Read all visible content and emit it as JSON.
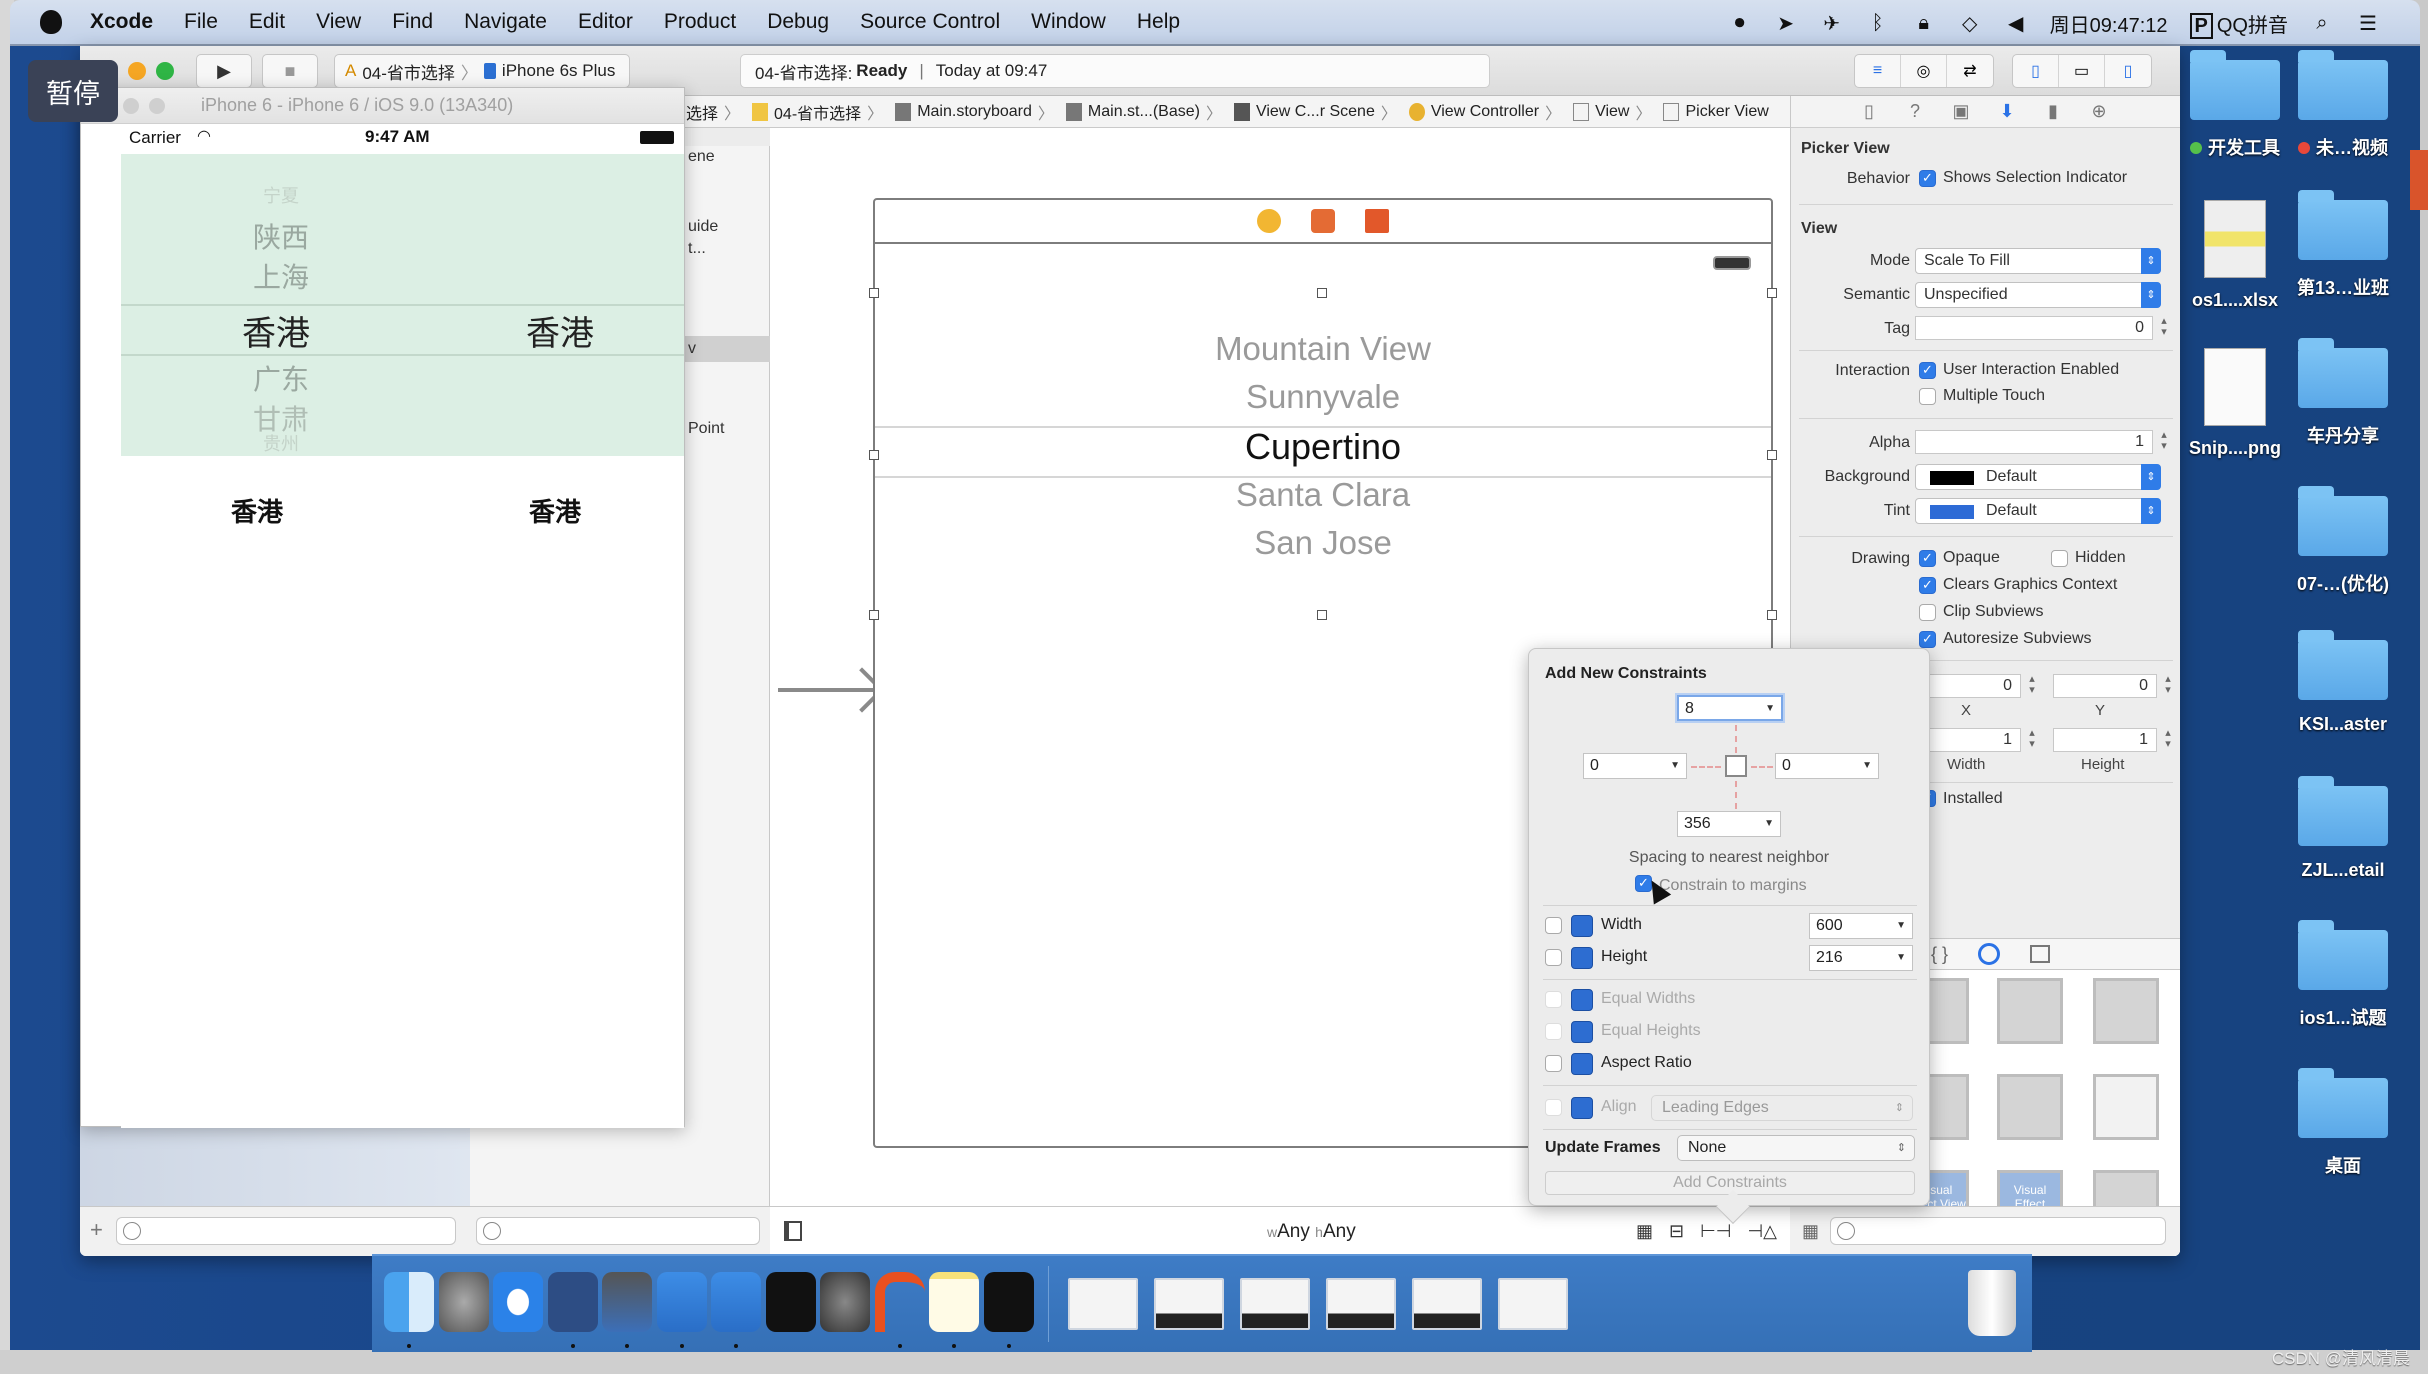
{
  "menubar": {
    "app_name": "Xcode",
    "items": [
      "File",
      "Edit",
      "View",
      "Find",
      "Navigate",
      "Editor",
      "Product",
      "Debug",
      "Source Control",
      "Window",
      "Help"
    ],
    "clock": "周日09:47:12",
    "input_method": "QQ拼音",
    "status_icons": [
      "screen-record-icon",
      "location-icon",
      "airplane-icon",
      "bluetooth-icon",
      "lock-icon",
      "wifi-icon",
      "volume-icon"
    ]
  },
  "overlay": {
    "pause_label": "暂停"
  },
  "toolbar": {
    "scheme_target": "04-省市选择",
    "scheme_device": "iPhone 6s Plus",
    "activity_project": "04-省市选择:",
    "activity_status": "Ready",
    "activity_time": "Today at 09:47"
  },
  "simulator": {
    "window_title": "iPhone 6 - iPhone 6 / iOS 9.0 (13A340)",
    "carrier": "Carrier",
    "time": "9:47 AM",
    "province_column": [
      "宁夏",
      "陕西",
      "上海",
      "香港",
      "广东",
      "甘肃",
      "贵州"
    ],
    "province_selected_index": 3,
    "city_column_selected": "香港",
    "label_province": "香港",
    "label_city": "香港"
  },
  "jumpbar": {
    "crumbs": [
      "选择",
      "04-省市选择",
      "Main.storyboard",
      "Main.st...(Base)",
      "View C...r Scene",
      "View Controller",
      "View",
      "Picker View"
    ]
  },
  "outline": {
    "items": [
      "ene",
      "uide",
      "t...",
      "v",
      "Point"
    ]
  },
  "canvas": {
    "picker_rows": [
      "Mountain View",
      "Sunnyvale",
      "Cupertino",
      "Santa Clara",
      "San Jose"
    ],
    "picker_selected_index": 2
  },
  "inspector": {
    "picker_section": "Picker View",
    "behavior_label": "Behavior",
    "shows_selection_indicator": {
      "label": "Shows Selection Indicator",
      "checked": true
    },
    "view_section": "View",
    "mode": {
      "label": "Mode",
      "value": "Scale To Fill"
    },
    "semantic": {
      "label": "Semantic",
      "value": "Unspecified"
    },
    "tag": {
      "label": "Tag",
      "value": "0"
    },
    "interaction_label": "Interaction",
    "user_interaction_enabled": {
      "label": "User Interaction Enabled",
      "checked": true
    },
    "multiple_touch": {
      "label": "Multiple Touch",
      "checked": false
    },
    "alpha": {
      "label": "Alpha",
      "value": "1"
    },
    "background": {
      "label": "Background",
      "value": "Default",
      "swatch": "#000000"
    },
    "tint": {
      "label": "Tint",
      "value": "Default",
      "swatch": "#2e6bd6"
    },
    "drawing_label": "Drawing",
    "opaque": {
      "label": "Opaque",
      "checked": true
    },
    "hidden": {
      "label": "Hidden",
      "checked": false
    },
    "clears_graphics_context": {
      "label": "Clears Graphics Context",
      "checked": true
    },
    "clip_subviews": {
      "label": "Clip Subviews",
      "checked": false
    },
    "autoresize_subviews": {
      "label": "Autoresize Subviews",
      "checked": true
    },
    "x": {
      "label": "X",
      "value": "0"
    },
    "y": {
      "label": "Y",
      "value": "0"
    },
    "width": {
      "label": "Width",
      "value": "1"
    },
    "height": {
      "label": "Height",
      "value": "1"
    },
    "installed": {
      "label": "Installed",
      "checked": true
    },
    "library_tabs": [
      "{}",
      "object-library",
      "media-library"
    ],
    "library_items": [
      "Visual Effect View",
      "Visual Effect Views"
    ]
  },
  "constraints_popover": {
    "title": "Add New Constraints",
    "top": "8",
    "left": "0",
    "right": "0",
    "bottom": "356",
    "spacing_caption": "Spacing to nearest neighbor",
    "constrain_to_margins": {
      "label": "Constrain to margins",
      "checked": true
    },
    "width": {
      "label": "Width",
      "value": "600",
      "checked": false
    },
    "height": {
      "label": "Height",
      "value": "216",
      "checked": false
    },
    "equal_widths": {
      "label": "Equal Widths",
      "checked": false,
      "enabled": false
    },
    "equal_heights": {
      "label": "Equal Heights",
      "checked": false,
      "enabled": false
    },
    "aspect_ratio": {
      "label": "Aspect Ratio",
      "checked": false
    },
    "align": {
      "label": "Align",
      "value": "Leading Edges",
      "enabled": false
    },
    "update_frames_label": "Update Frames",
    "update_frames_value": "None",
    "add_button": "Add Constraints"
  },
  "bottom_bar": {
    "size_class_w_prefix": "w",
    "size_class_w": "Any",
    "size_class_h_prefix": "h",
    "size_class_h": "Any"
  },
  "desktop": {
    "icons": [
      {
        "label": "开发工具",
        "tag": "#55c04a",
        "kind": "folder"
      },
      {
        "label": "未…视频",
        "tag": "#e8483a",
        "kind": "folder"
      },
      {
        "label": "os1....xlsx",
        "kind": "xlsx"
      },
      {
        "label": "第13…业班",
        "kind": "folder"
      },
      {
        "label": "Snip....png",
        "kind": "png"
      },
      {
        "label": "车丹分享",
        "kind": "folder"
      },
      {
        "label": "07-…(优化)",
        "kind": "folder"
      },
      {
        "label": "KSI...aster",
        "kind": "folder"
      },
      {
        "label": "ZJL...etail",
        "kind": "folder"
      },
      {
        "label": "ios1...试题",
        "kind": "folder"
      },
      {
        "label": "桌面",
        "kind": "folder"
      }
    ]
  },
  "dock": {
    "apps": [
      "Finder",
      "Launchpad",
      "Safari",
      "Mouse",
      "Photo Booth",
      "Xcode",
      "Instruments",
      "Terminal",
      "System Preferences",
      "WPS",
      "Notes",
      "Console"
    ],
    "running": [
      0,
      3,
      4,
      5,
      6,
      9,
      10,
      11
    ],
    "windows": [
      "window-1",
      "window-2",
      "window-3",
      "window-4",
      "window-5",
      "window-6"
    ],
    "trash": "Trash"
  },
  "watermark": "CSDN @清风清晨"
}
